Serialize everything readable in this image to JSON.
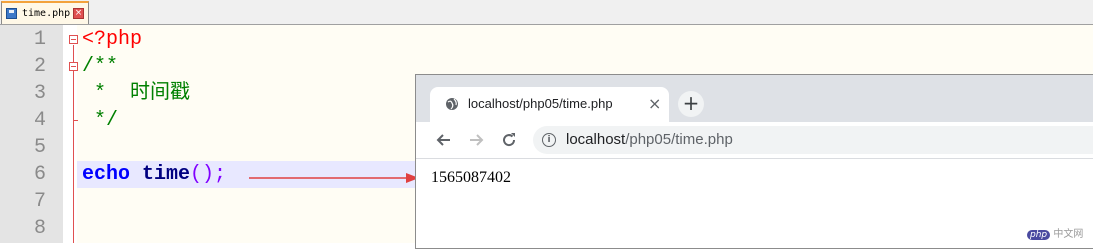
{
  "editor": {
    "tab_name": "time.php",
    "line_numbers": [
      "1",
      "2",
      "3",
      "4",
      "5",
      "6",
      "7",
      "8"
    ],
    "lines": {
      "l1": "<?php",
      "l2": "/**",
      "l3": " *  时间戳",
      "l4": " */",
      "l6_keyword": "echo",
      "l6_func": "time",
      "l6_rest": "();"
    }
  },
  "browser": {
    "tab_title": "localhost/php05/time.php",
    "url_host": "localhost",
    "url_path": "/php05/time.php",
    "page_output": "1565087402"
  },
  "watermark": {
    "badge": "php",
    "text": "中文网"
  },
  "colors": {
    "php_tag": "#ff0000",
    "comment": "#008000",
    "keyword": "#0000ff",
    "arrow": "#e04040"
  }
}
